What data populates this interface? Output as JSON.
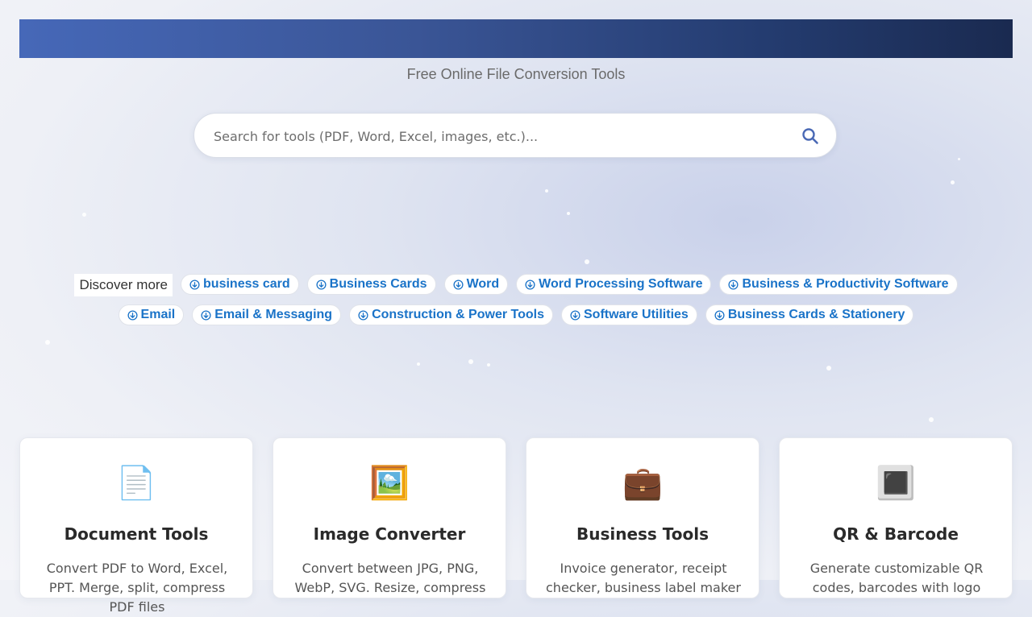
{
  "header": {
    "subtitle": "Free Online File Conversion Tools"
  },
  "search": {
    "placeholder": "Search for tools (PDF, Word, Excel, images, etc.)...",
    "icon": "search-icon"
  },
  "discover": {
    "label": "Discover more",
    "chips": [
      {
        "label": "business card"
      },
      {
        "label": "Business Cards"
      },
      {
        "label": "Word"
      },
      {
        "label": "Word Processing Software"
      },
      {
        "label": "Business & Productivity Software"
      },
      {
        "label": "Email"
      },
      {
        "label": "Email & Messaging"
      },
      {
        "label": "Construction & Power Tools"
      },
      {
        "label": "Software Utilities"
      },
      {
        "label": "Business Cards & Stationery"
      }
    ]
  },
  "cards": [
    {
      "icon": "📄",
      "icon_name": "document-icon",
      "title": "Document Tools",
      "desc": "Convert PDF to Word, Excel, PPT. Merge, split, compress PDF files"
    },
    {
      "icon": "🖼️",
      "icon_name": "image-icon",
      "title": "Image Converter",
      "desc": "Convert between JPG, PNG, WebP, SVG. Resize, compress"
    },
    {
      "icon": "💼",
      "icon_name": "briefcase-icon",
      "title": "Business Tools",
      "desc": "Invoice generator, receipt checker, business label maker"
    },
    {
      "icon": "🔳",
      "icon_name": "qr-code-icon",
      "title": "QR & Barcode",
      "desc": "Generate customizable QR codes, barcodes with logo"
    }
  ],
  "colors": {
    "accent": "#1a73c8",
    "banner_start": "#4668b8",
    "banner_end": "#1a2a50"
  }
}
